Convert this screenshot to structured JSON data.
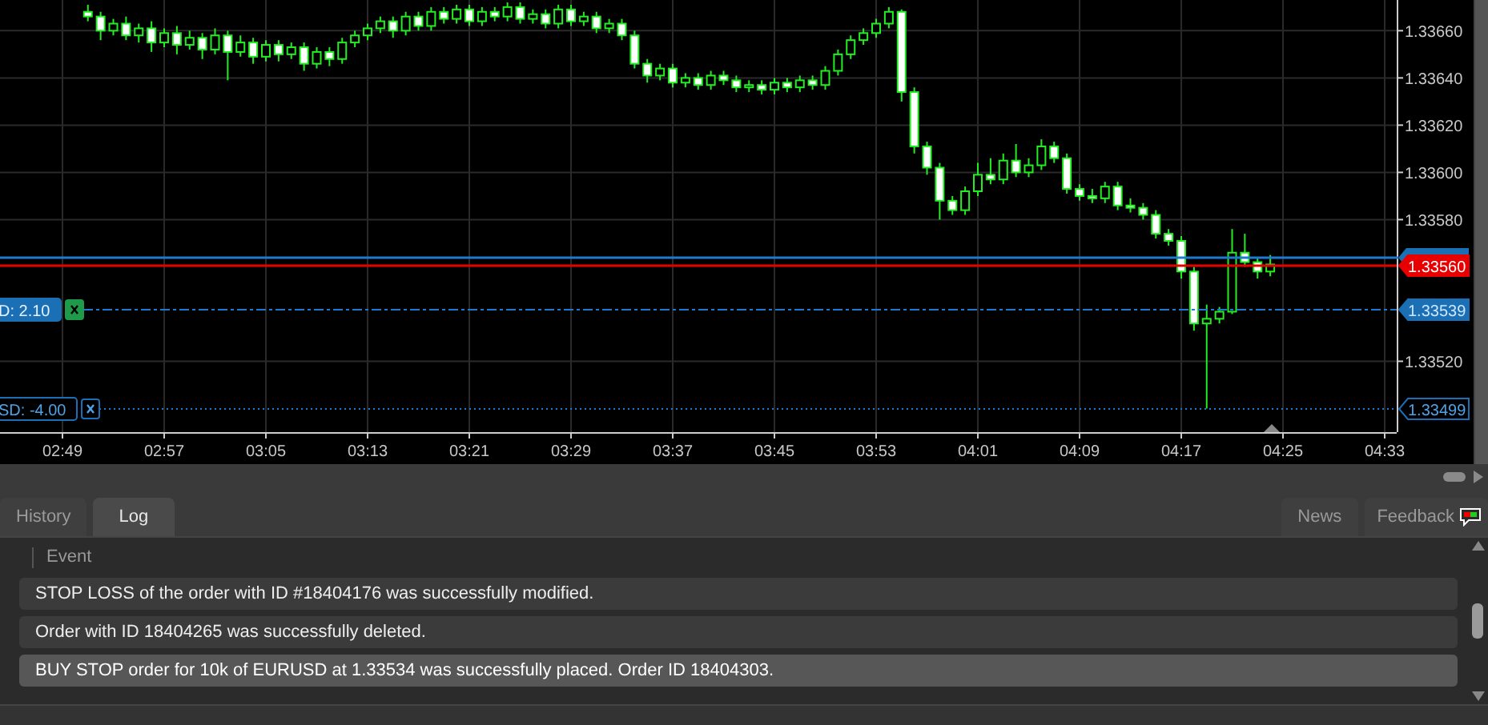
{
  "chart": {
    "chart_data": {
      "type": "candlestick",
      "ylim": [
        1.3349,
        1.33673
      ],
      "grid": true,
      "categories": [
        "02:49",
        null,
        null,
        null,
        null,
        null,
        null,
        null,
        "02:57",
        null,
        null,
        null,
        null,
        null,
        null,
        null,
        "03:05",
        null,
        null,
        null,
        null,
        null,
        null,
        null,
        "03:13",
        null,
        null,
        null,
        null,
        null,
        null,
        null,
        "03:21",
        null,
        null,
        null,
        null,
        null,
        null,
        null,
        "03:29",
        null,
        null,
        null,
        null,
        null,
        null,
        null,
        "03:37",
        null,
        null,
        null,
        null,
        null,
        null,
        null,
        "03:45",
        null,
        null,
        null,
        null,
        null,
        null,
        null,
        "03:53",
        null,
        null,
        null,
        null,
        null,
        null,
        null,
        "04:01",
        null,
        null,
        null,
        null,
        null,
        null,
        null,
        "04:09",
        null,
        null,
        null,
        null,
        null,
        null,
        null,
        "04:17",
        null,
        null,
        null,
        null,
        null,
        null,
        null,
        "04:25",
        null,
        null,
        null,
        null,
        null,
        null,
        null,
        "04:33"
      ],
      "yticks": [
        {
          "value": 1.3366,
          "label": "1.33660"
        },
        {
          "value": 1.3364,
          "label": "1.33640"
        },
        {
          "value": 1.3362,
          "label": "1.33620"
        },
        {
          "value": 1.336,
          "label": "1.33600"
        },
        {
          "value": 1.3358,
          "label": "1.33580"
        },
        {
          "value": 1.3352,
          "label": "1.33520"
        }
      ],
      "ohlc": [
        null,
        null,
        [
          1.33668,
          1.33671,
          1.33664,
          1.33666
        ],
        [
          1.33666,
          1.33668,
          1.33656,
          1.3366
        ],
        [
          1.3366,
          1.33665,
          1.33658,
          1.33663
        ],
        [
          1.33663,
          1.33666,
          1.33656,
          1.33658
        ],
        [
          1.33658,
          1.33663,
          1.33655,
          1.33661
        ],
        [
          1.33661,
          1.33664,
          1.33651,
          1.33655
        ],
        [
          1.33655,
          1.33661,
          1.33653,
          1.33659
        ],
        [
          1.33659,
          1.33662,
          1.3365,
          1.33654
        ],
        [
          1.33654,
          1.3366,
          1.33652,
          1.33657
        ],
        [
          1.33657,
          1.33659,
          1.33648,
          1.33652
        ],
        [
          1.33652,
          1.33661,
          1.3365,
          1.33658
        ],
        [
          1.33658,
          1.3366,
          1.33639,
          1.33651
        ],
        [
          1.33651,
          1.33658,
          1.33649,
          1.33655
        ],
        [
          1.33655,
          1.33657,
          1.33646,
          1.33649
        ],
        [
          1.33649,
          1.33656,
          1.33647,
          1.33654
        ],
        [
          1.33654,
          1.33656,
          1.33647,
          1.3365
        ],
        [
          1.3365,
          1.33655,
          1.33648,
          1.33653
        ],
        [
          1.33653,
          1.33655,
          1.33643,
          1.33646
        ],
        [
          1.33646,
          1.33653,
          1.33644,
          1.33651
        ],
        [
          1.33651,
          1.33653,
          1.33645,
          1.33648
        ],
        [
          1.33648,
          1.33657,
          1.33646,
          1.33655
        ],
        [
          1.33655,
          1.3366,
          1.33653,
          1.33658
        ],
        [
          1.33658,
          1.33663,
          1.33656,
          1.33661
        ],
        [
          1.33661,
          1.33666,
          1.33659,
          1.33664
        ],
        [
          1.33664,
          1.33666,
          1.33657,
          1.3366
        ],
        [
          1.3366,
          1.33668,
          1.33658,
          1.33666
        ],
        [
          1.33666,
          1.33668,
          1.3366,
          1.33662
        ],
        [
          1.33662,
          1.3367,
          1.3366,
          1.33668
        ],
        [
          1.33668,
          1.3367,
          1.33663,
          1.33665
        ],
        [
          1.33665,
          1.33671,
          1.33663,
          1.33669
        ],
        [
          1.33669,
          1.33671,
          1.33662,
          1.33664
        ],
        [
          1.33664,
          1.3367,
          1.33662,
          1.33668
        ],
        [
          1.33668,
          1.3367,
          1.33664,
          1.33666
        ],
        [
          1.33666,
          1.33672,
          1.33664,
          1.3367
        ],
        [
          1.3367,
          1.33672,
          1.33663,
          1.33665
        ],
        [
          1.33665,
          1.33669,
          1.33663,
          1.33667
        ],
        [
          1.33667,
          1.33669,
          1.33661,
          1.33663
        ],
        [
          1.33663,
          1.33671,
          1.33661,
          1.33669
        ],
        [
          1.33669,
          1.33671,
          1.33662,
          1.33664
        ],
        [
          1.33664,
          1.33668,
          1.33662,
          1.33666
        ],
        [
          1.33666,
          1.33668,
          1.33659,
          1.33661
        ],
        [
          1.33661,
          1.33665,
          1.33659,
          1.33663
        ],
        [
          1.33663,
          1.33665,
          1.33656,
          1.33658
        ],
        [
          1.33658,
          1.3366,
          1.33644,
          1.33646
        ],
        [
          1.33646,
          1.33648,
          1.33638,
          1.33641
        ],
        [
          1.33641,
          1.33646,
          1.33639,
          1.33644
        ],
        [
          1.33644,
          1.33646,
          1.33636,
          1.33638
        ],
        [
          1.33638,
          1.33642,
          1.33636,
          1.3364
        ],
        [
          1.3364,
          1.33642,
          1.33635,
          1.33637
        ],
        [
          1.33637,
          1.33643,
          1.33635,
          1.33641
        ],
        [
          1.33641,
          1.33643,
          1.33637,
          1.33639
        ],
        [
          1.33639,
          1.33641,
          1.33634,
          1.33636
        ],
        [
          1.33636,
          1.33639,
          1.33634,
          1.33637
        ],
        [
          1.33637,
          1.33639,
          1.33633,
          1.33635
        ],
        [
          1.33635,
          1.3364,
          1.33633,
          1.33638
        ],
        [
          1.33638,
          1.3364,
          1.33634,
          1.33636
        ],
        [
          1.33636,
          1.33641,
          1.33634,
          1.33639
        ],
        [
          1.33639,
          1.33641,
          1.33635,
          1.33637
        ],
        [
          1.33637,
          1.33645,
          1.33635,
          1.33643
        ],
        [
          1.33643,
          1.33652,
          1.33641,
          1.3365
        ],
        [
          1.3365,
          1.33658,
          1.33648,
          1.33656
        ],
        [
          1.33656,
          1.33661,
          1.33654,
          1.33659
        ],
        [
          1.33659,
          1.33665,
          1.33657,
          1.33663
        ],
        [
          1.33663,
          1.3367,
          1.33661,
          1.33668
        ],
        [
          1.33668,
          1.33669,
          1.3363,
          1.33634
        ],
        [
          1.33634,
          1.33636,
          1.33608,
          1.33611
        ],
        [
          1.33611,
          1.33613,
          1.33599,
          1.33602
        ],
        [
          1.33602,
          1.33604,
          1.3358,
          1.33588
        ],
        [
          1.33588,
          1.3359,
          1.33582,
          1.33584
        ],
        [
          1.33584,
          1.33594,
          1.33582,
          1.33592
        ],
        [
          1.33592,
          1.33604,
          1.3359,
          1.33599
        ],
        [
          1.33599,
          1.33606,
          1.33595,
          1.33597
        ],
        [
          1.33597,
          1.33608,
          1.33595,
          1.33605
        ],
        [
          1.33605,
          1.33612,
          1.33598,
          1.336
        ],
        [
          1.336,
          1.33606,
          1.33598,
          1.33603
        ],
        [
          1.33603,
          1.33614,
          1.33601,
          1.33611
        ],
        [
          1.33611,
          1.33613,
          1.33604,
          1.33606
        ],
        [
          1.33606,
          1.33608,
          1.33591,
          1.33593
        ],
        [
          1.33593,
          1.33595,
          1.33588,
          1.3359
        ],
        [
          1.3359,
          1.33593,
          1.33587,
          1.33589
        ],
        [
          1.33589,
          1.33596,
          1.33587,
          1.33594
        ],
        [
          1.33594,
          1.33596,
          1.33584,
          1.33586
        ],
        [
          1.33586,
          1.33589,
          1.33583,
          1.33585
        ],
        [
          1.33585,
          1.33587,
          1.3358,
          1.33582
        ],
        [
          1.33582,
          1.33584,
          1.33572,
          1.33574
        ],
        [
          1.33574,
          1.33576,
          1.33569,
          1.33571
        ],
        [
          1.33571,
          1.33573,
          1.33555,
          1.33558
        ],
        [
          1.33558,
          1.3356,
          1.33533,
          1.33536
        ],
        [
          1.33536,
          1.33544,
          1.335,
          1.33538
        ],
        [
          1.33538,
          1.33543,
          1.33536,
          1.33541
        ],
        [
          1.33541,
          1.33576,
          1.3354,
          1.33566
        ],
        [
          1.33566,
          1.33574,
          1.3356,
          1.33562
        ],
        [
          1.33562,
          1.33564,
          1.33555,
          1.33558
        ],
        [
          1.33558,
          1.33565,
          1.33556,
          1.33561
        ],
        null,
        null,
        null,
        null,
        null,
        null,
        null,
        null,
        null
      ]
    },
    "price_tags": [
      {
        "kind": "bid",
        "text": "1.33560"
      },
      {
        "kind": "order",
        "text": "1.33539"
      },
      {
        "kind": "stop",
        "text": "1.33499"
      }
    ],
    "orders": [
      {
        "kind": "pending",
        "label": "D: 2.10"
      },
      {
        "kind": "stop",
        "label": "SD: -4.00"
      }
    ]
  },
  "tabs": [
    {
      "label": "History",
      "selected": false
    },
    {
      "label": "Log",
      "selected": true
    }
  ],
  "right_tabs": [
    {
      "label": "News"
    },
    {
      "label": "Feedback"
    }
  ],
  "log": {
    "column": "Event",
    "rows": [
      {
        "text": "STOP LOSS of the order with ID #18404176 was successfully modified.",
        "selected": false
      },
      {
        "text": "Order with ID 18404265 was successfully deleted.",
        "selected": false
      },
      {
        "text": "BUY STOP order for 10k of EURUSD at 1.33534 was successfully placed. Order ID 18404303.",
        "selected": true
      }
    ]
  }
}
